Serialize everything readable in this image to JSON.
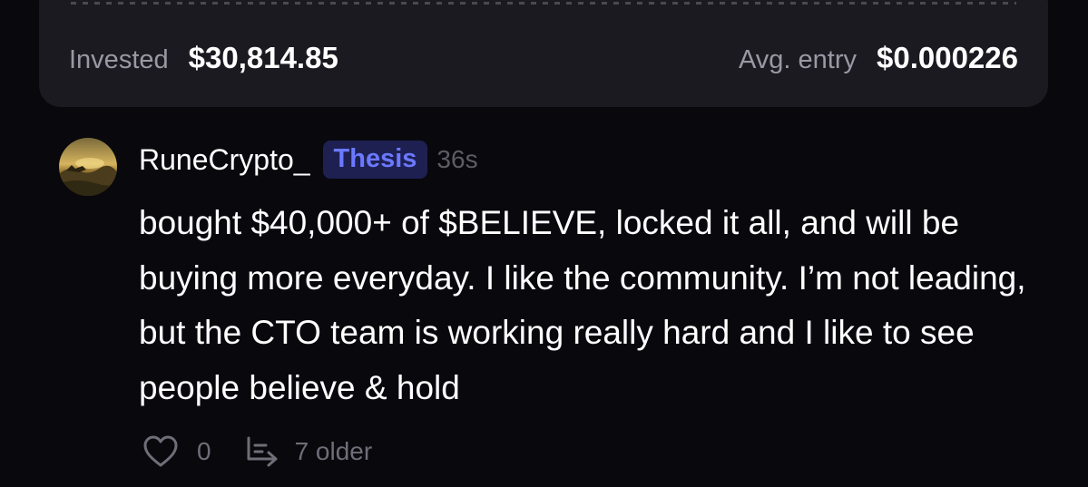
{
  "position_card": {
    "invested_label": "Invested",
    "invested_value": "$30,814.85",
    "avg_entry_label": "Avg. entry",
    "avg_entry_value": "$0.000226"
  },
  "comment": {
    "username": "RuneCrypto_",
    "badge": "Thesis",
    "time_ago": "36s",
    "text": "bought $40,000+ of $BELIEVE, locked it all, and will be buying more everyday. I like the community. I’m not leading, but the CTO team is working really hard and I like to see people believe & hold",
    "like_count": "0",
    "older_label": "7 older",
    "icons": {
      "avatar": "avatar-landscape",
      "like": "heart-icon",
      "older": "reply-thread-icon"
    }
  },
  "colors": {
    "background": "#09080d",
    "card": "#1b1a21",
    "badge_bg": "#1e2052",
    "badge_text": "#6b79ff",
    "muted_text": "#9a99a3",
    "action_text": "#6f6e78"
  }
}
